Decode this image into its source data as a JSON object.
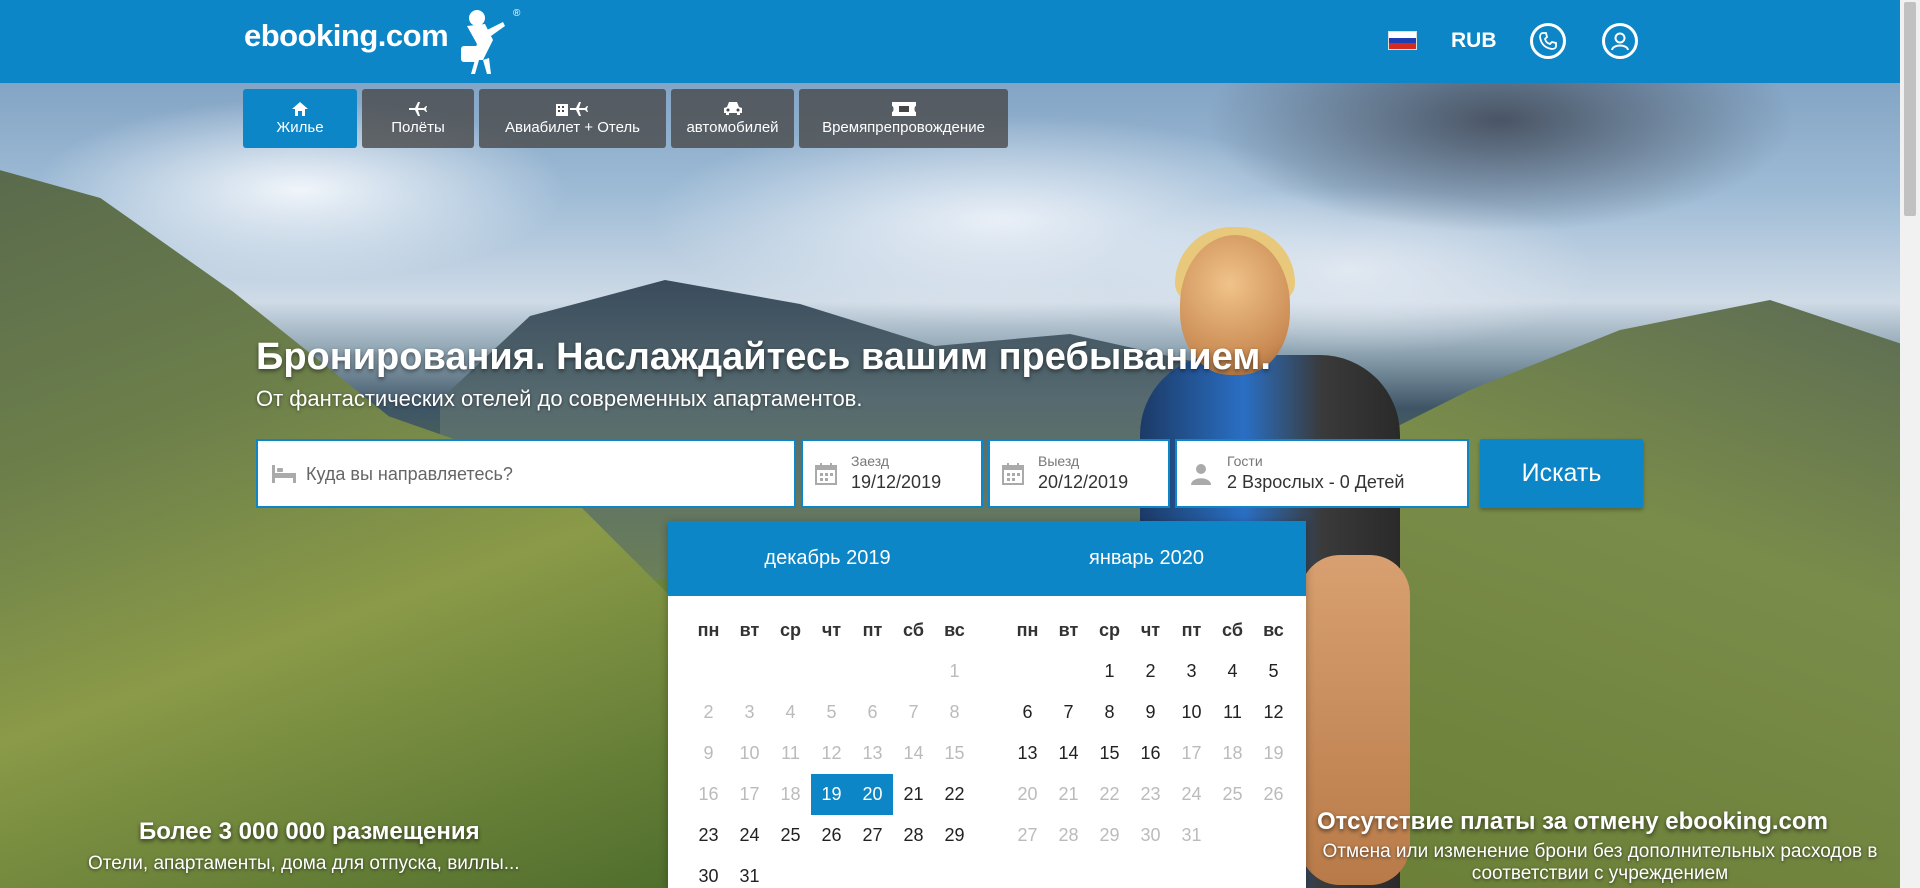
{
  "header": {
    "logo_text": "ebooking.com",
    "logo_registered": "®",
    "currency": "RUB",
    "flag": "russia-flag",
    "phone_icon": "phone-icon",
    "user_icon": "user-icon"
  },
  "tabs": [
    {
      "label": "Жилье",
      "icon": "home-icon",
      "active": true
    },
    {
      "label": "Полёты",
      "icon": "plane-icon",
      "active": false
    },
    {
      "label": "Авиабилет + Отель",
      "icon": "hotel-plane-icon",
      "active": false
    },
    {
      "label": "автомобилей",
      "icon": "car-icon",
      "active": false
    },
    {
      "label": "Времяпрепровождение",
      "icon": "ticket-icon",
      "active": false
    }
  ],
  "hero": {
    "title": "Бронирования. Наслаждайтесь вашим пребыванием.",
    "subtitle": "От фантастических отелей до современных апартаментов."
  },
  "search": {
    "destination_placeholder": "Куда вы направляетесь?",
    "checkin_label": "Заезд",
    "checkin_value": "19/12/2019",
    "checkout_label": "Выезд",
    "checkout_value": "20/12/2019",
    "guests_label": "Гости",
    "guests_value": "2 Взрослых - 0 Детей",
    "button_label": "Искать"
  },
  "calendar": {
    "weekdays": [
      "пн",
      "вт",
      "ср",
      "чт",
      "пт",
      "сб",
      "вс"
    ],
    "months": [
      {
        "title": "декабрь 2019",
        "weeks": [
          [
            null,
            null,
            null,
            null,
            null,
            null,
            {
              "d": "1",
              "s": "past"
            }
          ],
          [
            {
              "d": "2",
              "s": "past"
            },
            {
              "d": "3",
              "s": "past"
            },
            {
              "d": "4",
              "s": "past"
            },
            {
              "d": "5",
              "s": "past"
            },
            {
              "d": "6",
              "s": "past"
            },
            {
              "d": "7",
              "s": "past"
            },
            {
              "d": "8",
              "s": "past"
            }
          ],
          [
            {
              "d": "9",
              "s": "past"
            },
            {
              "d": "10",
              "s": "past"
            },
            {
              "d": "11",
              "s": "past"
            },
            {
              "d": "12",
              "s": "past"
            },
            {
              "d": "13",
              "s": "past"
            },
            {
              "d": "14",
              "s": "past"
            },
            {
              "d": "15",
              "s": "past"
            }
          ],
          [
            {
              "d": "16",
              "s": "past"
            },
            {
              "d": "17",
              "s": "past"
            },
            {
              "d": "18",
              "s": "past"
            },
            {
              "d": "19",
              "s": "sel"
            },
            {
              "d": "20",
              "s": "sel"
            },
            {
              "d": "21",
              "s": ""
            },
            {
              "d": "22",
              "s": ""
            }
          ],
          [
            {
              "d": "23",
              "s": ""
            },
            {
              "d": "24",
              "s": ""
            },
            {
              "d": "25",
              "s": ""
            },
            {
              "d": "26",
              "s": ""
            },
            {
              "d": "27",
              "s": ""
            },
            {
              "d": "28",
              "s": ""
            },
            {
              "d": "29",
              "s": ""
            }
          ],
          [
            {
              "d": "30",
              "s": ""
            },
            {
              "d": "31",
              "s": ""
            },
            null,
            null,
            null,
            null,
            null
          ]
        ]
      },
      {
        "title": "январь 2020",
        "weeks": [
          [
            null,
            null,
            {
              "d": "1",
              "s": ""
            },
            {
              "d": "2",
              "s": ""
            },
            {
              "d": "3",
              "s": ""
            },
            {
              "d": "4",
              "s": ""
            },
            {
              "d": "5",
              "s": ""
            }
          ],
          [
            {
              "d": "6",
              "s": ""
            },
            {
              "d": "7",
              "s": ""
            },
            {
              "d": "8",
              "s": ""
            },
            {
              "d": "9",
              "s": ""
            },
            {
              "d": "10",
              "s": ""
            },
            {
              "d": "11",
              "s": ""
            },
            {
              "d": "12",
              "s": ""
            }
          ],
          [
            {
              "d": "13",
              "s": ""
            },
            {
              "d": "14",
              "s": ""
            },
            {
              "d": "15",
              "s": ""
            },
            {
              "d": "16",
              "s": ""
            },
            {
              "d": "17",
              "s": "past"
            },
            {
              "d": "18",
              "s": "past"
            },
            {
              "d": "19",
              "s": "past"
            }
          ],
          [
            {
              "d": "20",
              "s": "past"
            },
            {
              "d": "21",
              "s": "past"
            },
            {
              "d": "22",
              "s": "past"
            },
            {
              "d": "23",
              "s": "past"
            },
            {
              "d": "24",
              "s": "past"
            },
            {
              "d": "25",
              "s": "past"
            },
            {
              "d": "26",
              "s": "past"
            }
          ],
          [
            {
              "d": "27",
              "s": "past"
            },
            {
              "d": "28",
              "s": "past"
            },
            {
              "d": "29",
              "s": "past"
            },
            {
              "d": "30",
              "s": "past"
            },
            {
              "d": "31",
              "s": "past"
            },
            null,
            null
          ]
        ]
      }
    ]
  },
  "promos": [
    {
      "title": "Более 3 000 000 размещения",
      "text": "Отели, апартаменты, дома для отпуска, виллы..."
    },
    {
      "title": "Отсутствие платы за отмену ebooking.com",
      "text": "Отмена или изменение брони без дополнительных расходов в соответствии с учреждением"
    }
  ],
  "colors": {
    "brand": "#0c86c6",
    "tab_inactive": "#464646"
  }
}
